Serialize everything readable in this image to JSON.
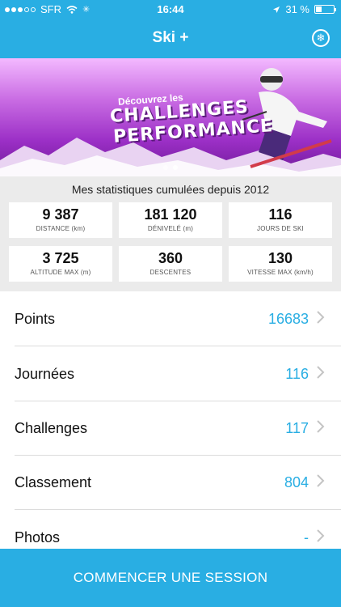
{
  "status": {
    "carrier": "SFR",
    "time": "16:44",
    "battery": "31 %",
    "battery_level": 0.31
  },
  "nav": {
    "title": "Ski +"
  },
  "banner": {
    "line1": "Découvrez les",
    "line2": "CHALLENGES",
    "line3": "PERFORMANCE"
  },
  "stats": {
    "title": "Mes statistiques cumulées depuis 2012",
    "cards": [
      {
        "value": "9 387",
        "label": "DISTANCE (km)"
      },
      {
        "value": "181 120",
        "label": "DÉNIVELÉ (m)"
      },
      {
        "value": "116",
        "label": "JOURS DE SKI"
      },
      {
        "value": "3 725",
        "label": "ALTITUDE MAX (m)"
      },
      {
        "value": "360",
        "label": "DESCENTES"
      },
      {
        "value": "130",
        "label": "VITESSE MAX (km/h)"
      }
    ]
  },
  "list": [
    {
      "label": "Points",
      "value": "16683"
    },
    {
      "label": "Journées",
      "value": "116"
    },
    {
      "label": "Challenges",
      "value": "117"
    },
    {
      "label": "Classement",
      "value": "804"
    },
    {
      "label": "Photos",
      "value": "-"
    }
  ],
  "cta": {
    "label": "COMMENCER UNE SESSION"
  },
  "colors": {
    "accent": "#29aee3",
    "banner": "#9b2fc6",
    "stats_bg": "#ebebeb"
  }
}
